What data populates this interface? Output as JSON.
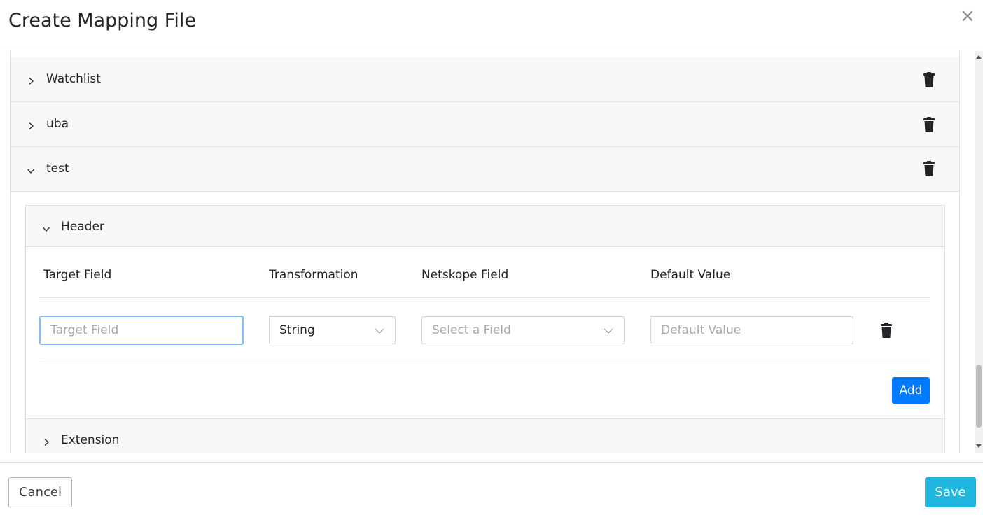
{
  "modal": {
    "title": "Create Mapping File",
    "close_symbol": "×",
    "close_icon": "close-icon"
  },
  "sections": [
    {
      "label": "Watchlist",
      "expanded": false
    },
    {
      "label": "uba",
      "expanded": false
    },
    {
      "label": "test",
      "expanded": true
    }
  ],
  "test_section": {
    "header_panel": {
      "label": "Header",
      "columns": {
        "target_field": "Target Field",
        "transformation": "Transformation",
        "netskope_field": "Netskope Field",
        "default_value": "Default Value"
      },
      "row": {
        "target_field_placeholder": "Target Field",
        "target_field_value": "",
        "transformation_value": "String",
        "netskope_field_placeholder": "Select a Field",
        "default_value_placeholder": "Default Value",
        "default_value_value": ""
      },
      "add_label": "Add"
    },
    "extension_panel": {
      "label": "Extension"
    }
  },
  "footer": {
    "cancel_label": "Cancel",
    "save_label": "Save"
  },
  "colors": {
    "primary": "#007bff",
    "save": "#1fb6e0",
    "panel_bg": "#f8f8f8"
  }
}
